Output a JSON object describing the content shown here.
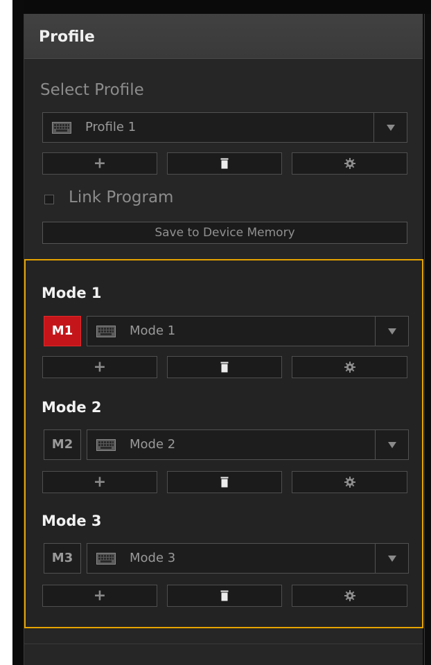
{
  "panel": {
    "title": "Profile"
  },
  "profile": {
    "select_label": "Select Profile",
    "selected_profile": "Profile 1",
    "add_glyph": "+",
    "link_program_label": "Link Program",
    "link_program_checked": false,
    "save_button_label": "Save to Device Memory"
  },
  "modes": [
    {
      "title": "Mode 1",
      "badge": "M1",
      "selected": "Mode 1",
      "active": true,
      "add_glyph": "+"
    },
    {
      "title": "Mode 2",
      "badge": "M2",
      "selected": "Mode 2",
      "active": false,
      "add_glyph": "+"
    },
    {
      "title": "Mode 3",
      "badge": "M3",
      "selected": "Mode 3",
      "active": false,
      "add_glyph": "+"
    }
  ],
  "icons": {
    "profile_item": "keyboard-icon",
    "dropdown": "triangle-down-icon",
    "add": "plus-icon",
    "delete": "trash-icon",
    "settings": "gear-icon"
  },
  "colors": {
    "panel_bg": "#262626",
    "accent_border": "#e7a400",
    "active_badge": "#c4161a"
  }
}
